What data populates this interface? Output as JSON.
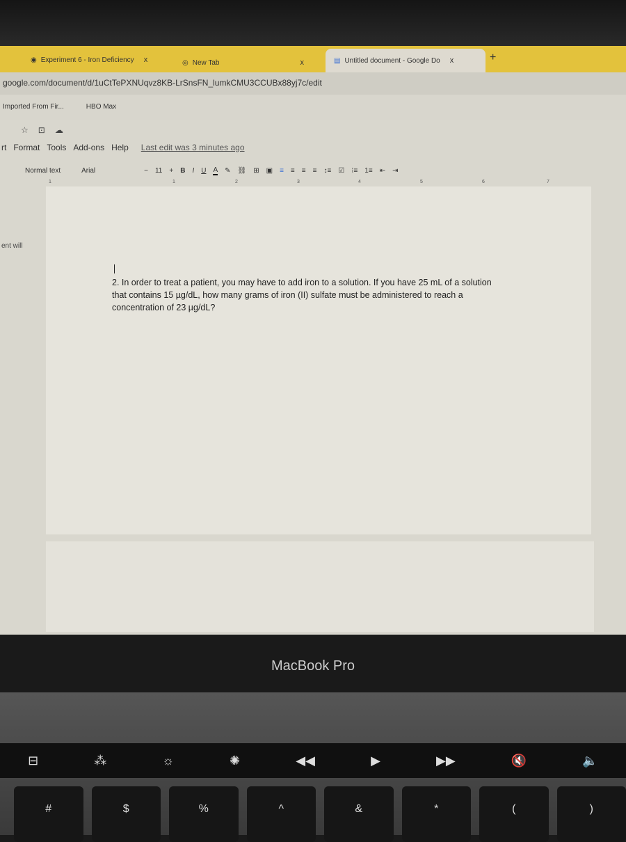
{
  "browser": {
    "tabs": [
      {
        "label": "Experiment 6 - Iron Deficiency"
      },
      {
        "label": "New Tab"
      },
      {
        "label": "Untitled document - Google Do",
        "active": true
      }
    ],
    "new_tab": "+",
    "close": "x",
    "url": "google.com/document/d/1uCtTePXNUqvz8KB-LrSnsFN_lumkCMU3CCUBx88yj7c/edit",
    "bookmarks": [
      "Imported From Fir...",
      "HBO Max"
    ]
  },
  "docs": {
    "menu": [
      "rt",
      "Format",
      "Tools",
      "Add-ons",
      "Help"
    ],
    "last_edit": "Last edit was 3 minutes ago",
    "toolbar": {
      "style": "Normal text",
      "font": "Arial",
      "minus": "−",
      "size": "11",
      "plus": "+",
      "bold": "B",
      "italic": "I",
      "underline": "U",
      "color": "A"
    },
    "ruler": [
      "1",
      "1",
      "2",
      "3",
      "4",
      "5",
      "6",
      "7"
    ],
    "side_text": "ent will",
    "paragraph": "2. In order to treat a patient, you may have to add iron to a solution. If you have 25 mL of a solution that contains 15 µg/dL, how many grams of iron (II) sulfate must be administered to reach a concentration of 23 µg/dL?"
  },
  "laptop": {
    "brand": "MacBook Pro",
    "keys": [
      "#",
      "$",
      "%",
      "^",
      "&",
      "*",
      "(",
      ")"
    ]
  },
  "colors": {
    "tabbar": "#e3c23c",
    "page": "#e6e4dc"
  }
}
